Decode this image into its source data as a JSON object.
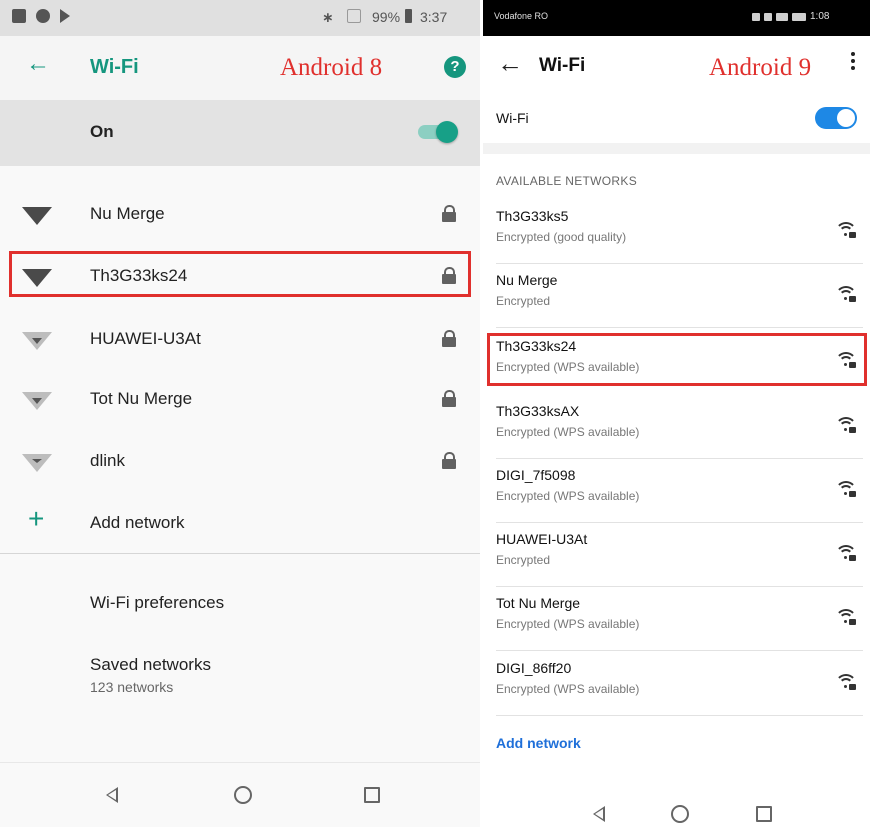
{
  "left": {
    "status": {
      "battery": "99%",
      "time": "3:37"
    },
    "appbar": {
      "title": "Wi-Fi",
      "label": "Android 8"
    },
    "wifi_toggle": {
      "label": "On",
      "state": "on"
    },
    "networks": [
      {
        "name": "Nu Merge",
        "locked": true,
        "signal": "strong"
      },
      {
        "name": "Th3G33ks24",
        "locked": true,
        "signal": "strong",
        "highlighted": true
      },
      {
        "name": "HUAWEI-U3At",
        "locked": true,
        "signal": "weak"
      },
      {
        "name": "Tot Nu Merge",
        "locked": true,
        "signal": "weak"
      },
      {
        "name": "dlink",
        "locked": true,
        "signal": "weak"
      }
    ],
    "add_network": "Add network",
    "preferences": "Wi-Fi preferences",
    "saved": {
      "title": "Saved networks",
      "subtitle": "123 networks"
    }
  },
  "right": {
    "status": {
      "carrier": "Vodafone RO",
      "time": "1:08"
    },
    "appbar": {
      "title": "Wi-Fi",
      "label": "Android 9"
    },
    "wifi_toggle": {
      "label": "Wi-Fi",
      "state": "on"
    },
    "section_title": "AVAILABLE NETWORKS",
    "networks": [
      {
        "name": "Th3G33ks5",
        "status": "Encrypted (good quality)"
      },
      {
        "name": "Nu Merge",
        "status": "Encrypted"
      },
      {
        "name": "Th3G33ks24",
        "status": "Encrypted (WPS available)",
        "highlighted": true
      },
      {
        "name": "Th3G33ksAX",
        "status": "Encrypted (WPS available)"
      },
      {
        "name": "DIGI_7f5098",
        "status": "Encrypted (WPS available)"
      },
      {
        "name": "HUAWEI-U3At",
        "status": "Encrypted"
      },
      {
        "name": "Tot Nu Merge",
        "status": "Encrypted (WPS available)"
      },
      {
        "name": "DIGI_86ff20",
        "status": "Encrypted (WPS available)"
      }
    ],
    "add_network": "Add network"
  },
  "colors": {
    "accent8": "#15967e",
    "accent9": "#1e88e5",
    "highlight": "#e0302d"
  }
}
